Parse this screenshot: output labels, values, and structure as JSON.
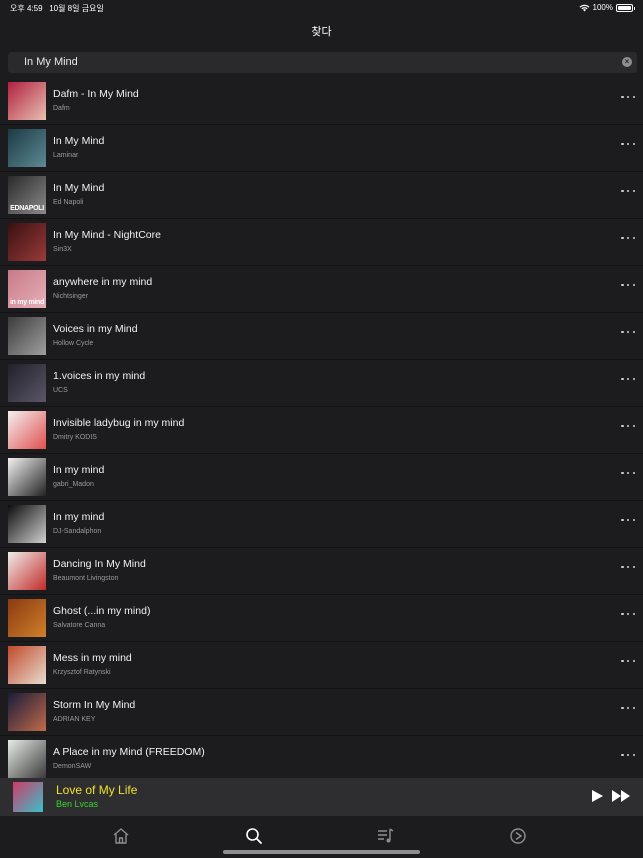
{
  "status_bar": {
    "time": "오후 4:59",
    "date": "10월 8일 금요일",
    "battery": "100%",
    "battery_level": 1.0
  },
  "nav": {
    "title": "찾다"
  },
  "search": {
    "value": "In My Mind"
  },
  "results": [
    {
      "title": "Dafm - In My Mind",
      "artist": "Dafm",
      "art": [
        "#b02040",
        "#e8c0b0"
      ]
    },
    {
      "title": "In My Mind",
      "artist": "Laminar",
      "art": [
        "#1c3a44",
        "#5c8a94"
      ]
    },
    {
      "title": "In My Mind",
      "artist": "Ed Napoli",
      "art": [
        "#2a2a2a",
        "#8a8a8a"
      ],
      "art_text": "EDNAPOLI"
    },
    {
      "title": "In My Mind - NightCore",
      "artist": "Sin3X",
      "art": [
        "#3a1010",
        "#9a3a3a"
      ]
    },
    {
      "title": "anywhere in my mind",
      "artist": "Nichtsinger",
      "art": [
        "#c87a88",
        "#e6b0b8"
      ],
      "art_text": "in my mind"
    },
    {
      "title": "Voices in my Mind",
      "artist": "Hollow Cycle",
      "art": [
        "#3c3c3c",
        "#a0a0a0"
      ]
    },
    {
      "title": "1.voices in my mind",
      "artist": "UCS",
      "art": [
        "#22202a",
        "#5a5668"
      ]
    },
    {
      "title": "Invisible ladybug in my mind",
      "artist": "Dmitry KODIS",
      "art": [
        "#f4f0f0",
        "#e05050"
      ]
    },
    {
      "title": "In my mind",
      "artist": "gabri_Madon",
      "art": [
        "#f2f2f2",
        "#222222"
      ]
    },
    {
      "title": "In my mind",
      "artist": "DJ-Sandalphon",
      "art": [
        "#0c0c0c",
        "#d0d0d0"
      ]
    },
    {
      "title": "Dancing In My Mind",
      "artist": "Beaumont Livingston",
      "art": [
        "#f0eeea",
        "#c02a2a"
      ]
    },
    {
      "title": "Ghost (...in my mind)",
      "artist": "Salvatore Canna",
      "art": [
        "#8a3a10",
        "#d0802a"
      ]
    },
    {
      "title": "Mess in my mind",
      "artist": "Krzysztof Ratynski",
      "art": [
        "#c04a2a",
        "#e8dcd0"
      ]
    },
    {
      "title": "Storm In My Mind",
      "artist": "ADRIAN KEY",
      "art": [
        "#1a1c3a",
        "#c06a4a"
      ]
    },
    {
      "title": "A Place in my Mind (FREEDOM)",
      "artist": "DemonSAW",
      "art": [
        "#e8ece8",
        "#3a3a3a"
      ]
    }
  ],
  "now_playing": {
    "title": "Love of My Life",
    "artist": "Ben Lvcas",
    "art": [
      "#d03a6a",
      "#3ac0c8"
    ]
  },
  "tabs": [
    {
      "name": "home-icon"
    },
    {
      "name": "search-icon"
    },
    {
      "name": "playlist-icon"
    },
    {
      "name": "settings-icon"
    }
  ],
  "colors": {
    "background": "#1c1c1e",
    "now_playing_title": "#f1e02a",
    "now_playing_artist": "#38d62c"
  }
}
